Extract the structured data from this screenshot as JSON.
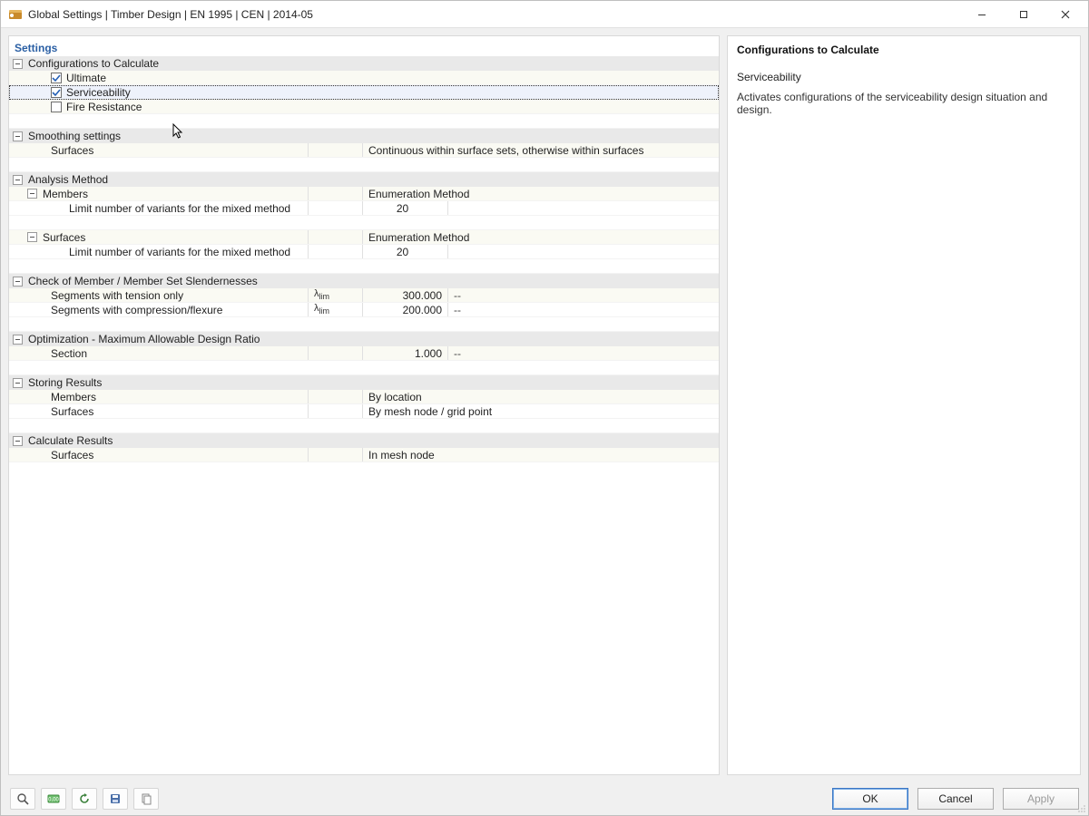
{
  "window": {
    "title": "Global Settings | Timber Design | EN 1995 | CEN | 2014-05"
  },
  "left": {
    "header": "Settings",
    "groups": {
      "configs": {
        "title": "Configurations to Calculate",
        "ultimate": "Ultimate",
        "serviceability": "Serviceability",
        "fire": "Fire Resistance"
      },
      "smoothing": {
        "title": "Smoothing settings",
        "surfaces_label": "Surfaces",
        "surfaces_value": "Continuous within surface sets, otherwise within surfaces"
      },
      "analysis": {
        "title": "Analysis Method",
        "members_label": "Members",
        "members_value": "Enumeration Method",
        "members_limit_label": "Limit number of variants for the mixed method",
        "members_limit_value": "20",
        "surfaces_label": "Surfaces",
        "surfaces_value": "Enumeration Method",
        "surfaces_limit_label": "Limit number of variants for the mixed method",
        "surfaces_limit_value": "20"
      },
      "slender": {
        "title": "Check of Member / Member Set Slendernesses",
        "tension_label": "Segments with tension only",
        "tension_value": "300.000",
        "tension_unit": "--",
        "comp_label": "Segments with compression/flexure",
        "comp_value": "200.000",
        "comp_unit": "--",
        "lambda": "λ"
      },
      "opt": {
        "title": "Optimization - Maximum Allowable Design Ratio",
        "section_label": "Section",
        "section_value": "1.000",
        "section_unit": "--"
      },
      "storing": {
        "title": "Storing Results",
        "members_label": "Members",
        "members_value": "By location",
        "surfaces_label": "Surfaces",
        "surfaces_value": "By mesh node / grid point"
      },
      "calc": {
        "title": "Calculate Results",
        "surfaces_label": "Surfaces",
        "surfaces_value": "In mesh node"
      }
    }
  },
  "right": {
    "title": "Configurations to Calculate",
    "subtitle": "Serviceability",
    "description": "Activates configurations of the serviceability design situation and design."
  },
  "footer": {
    "ok": "OK",
    "cancel": "Cancel",
    "apply": "Apply"
  },
  "lim_suffix": "lim"
}
